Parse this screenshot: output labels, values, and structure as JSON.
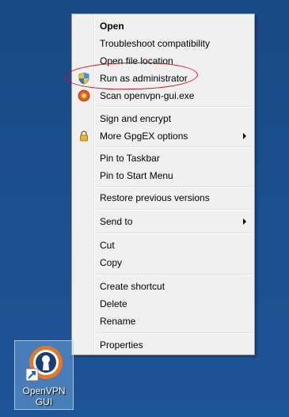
{
  "context_menu": {
    "groups": [
      [
        "Open",
        "Troubleshoot compatibility",
        "Open file location",
        "Run as administrator",
        "Scan openvpn-gui.exe"
      ],
      [
        "Sign and encrypt",
        "More GpgEX options"
      ],
      [
        "Pin to Taskbar",
        "Pin to Start Menu"
      ],
      [
        "Restore previous versions"
      ],
      [
        "Send to"
      ],
      [
        "Cut",
        "Copy"
      ],
      [
        "Create shortcut",
        "Delete",
        "Rename"
      ],
      [
        "Properties"
      ]
    ],
    "items": {
      "open": "Open",
      "troubleshoot": "Troubleshoot compatibility",
      "open_location": "Open file location",
      "run_as_admin": "Run as administrator",
      "scan": "Scan openvpn-gui.exe",
      "sign_encrypt": "Sign and encrypt",
      "gpgex": "More GpgEX options",
      "pin_taskbar": "Pin to Taskbar",
      "pin_start": "Pin to Start Menu",
      "restore": "Restore previous versions",
      "send_to": "Send to",
      "cut": "Cut",
      "copy": "Copy",
      "create_shortcut": "Create shortcut",
      "delete": "Delete",
      "rename": "Rename",
      "properties": "Properties"
    },
    "icons": {
      "run_as_admin": "uac-shield-icon",
      "scan": "antivirus-scan-icon",
      "gpgex": "lock-icon",
      "submenu": "submenu-arrow-icon"
    }
  },
  "annotation": {
    "highlight_color": "#d1141b",
    "target": "Run as administrator"
  },
  "desktop": {
    "background_color": "#1d4d8a",
    "shortcut": {
      "caption_line1": "OpenVPN",
      "caption_line2": "GUI",
      "icon": "openvpn-shortcut-icon"
    }
  }
}
